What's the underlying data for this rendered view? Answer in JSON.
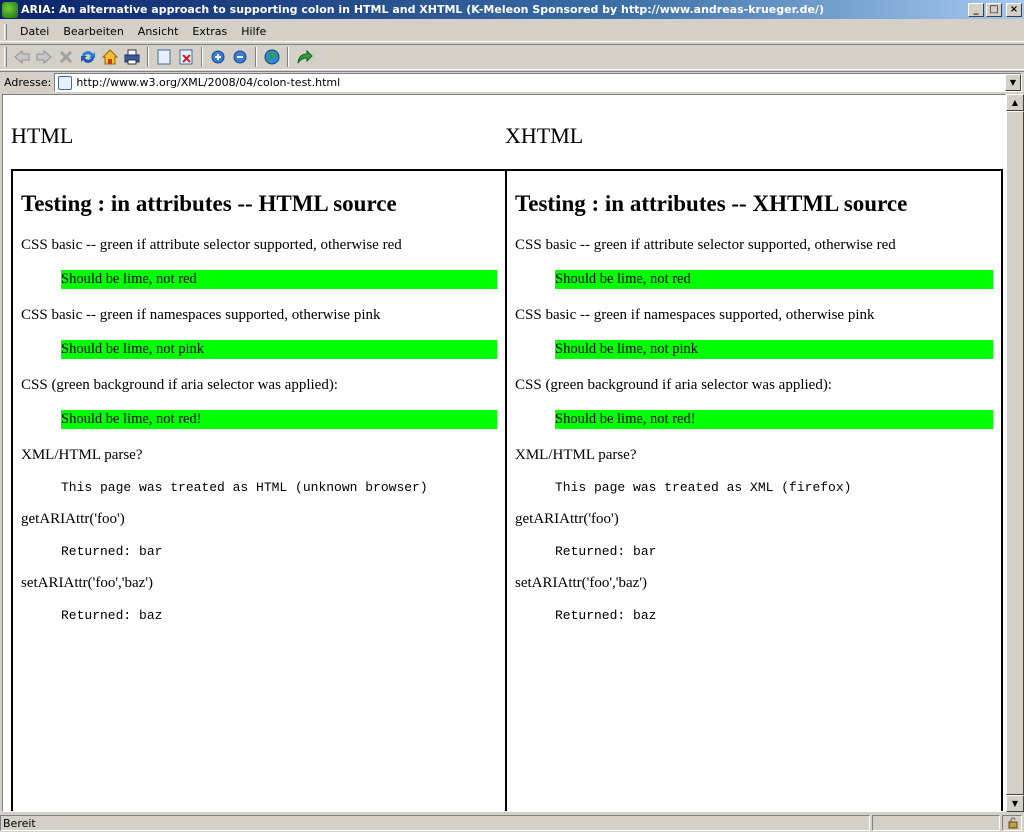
{
  "window": {
    "title": "ARIA: An alternative approach to supporting colon in HTML and XHTML (K-Meleon Sponsored by http://www.andreas-krueger.de/)",
    "controls": [
      "_",
      "□",
      "×"
    ]
  },
  "menu": {
    "items": [
      {
        "label": "Datei"
      },
      {
        "label": "Bearbeiten"
      },
      {
        "label": "Ansicht"
      },
      {
        "label": "Extras"
      },
      {
        "label": "Hilfe"
      }
    ]
  },
  "toolbar": {
    "icons": [
      "back-icon",
      "forward-icon",
      "stop-icon",
      "reload-icon",
      "home-icon",
      "print-icon",
      "new-window-icon",
      "close-window-icon",
      "zoom-in-icon",
      "zoom-out-icon",
      "globe-icon",
      "go-icon"
    ]
  },
  "address": {
    "label": "Adresse:",
    "url": "http://www.w3.org/XML/2008/04/colon-test.html"
  },
  "page": {
    "left_heading": "HTML",
    "right_heading": "XHTML",
    "left": {
      "title": "Testing : in attributes -- HTML source",
      "css_basic_label": "CSS basic -- green if attribute selector supported, otherwise red",
      "css_basic_result": "Should be lime, not red",
      "css_ns_label": "CSS basic -- green if namespaces supported, otherwise pink",
      "css_ns_result": "Should be lime, not pink",
      "css_aria_label": "CSS (green background if aria selector was applied):",
      "css_aria_result": "Should be lime, not red!",
      "parse_label": "XML/HTML parse?",
      "parse_result": "This page was treated as HTML (unknown browser)",
      "get_label": "getARIAttr('foo')",
      "get_result": "Returned: bar",
      "set_label": "setARIAttr('foo','baz')",
      "set_result": "Returned: baz"
    },
    "right": {
      "title": "Testing : in attributes -- XHTML source",
      "css_basic_label": "CSS basic -- green if attribute selector supported, otherwise red",
      "css_basic_result": "Should be lime, not red",
      "css_ns_label": "CSS basic -- green if namespaces supported, otherwise pink",
      "css_ns_result": "Should be lime, not pink",
      "css_aria_label": "CSS (green background if aria selector was applied):",
      "css_aria_result": "Should be lime, not red!",
      "parse_label": "XML/HTML parse?",
      "parse_result": "This page was treated as XML (firefox)",
      "get_label": "getARIAttr('foo')",
      "get_result": "Returned: bar",
      "set_label": "setARIAttr('foo','baz')",
      "set_result": "Returned: baz"
    }
  },
  "status": {
    "text": "Bereit"
  },
  "colors": {
    "lime": "#00ff00",
    "chrome": "#d4d0c8",
    "title_bar": "#0a246a"
  }
}
